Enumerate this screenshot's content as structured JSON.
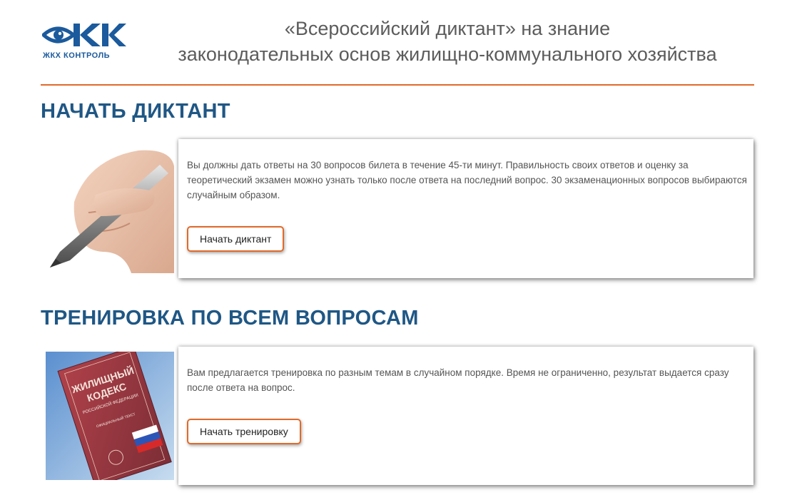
{
  "header": {
    "logo_text": "ЖКХ КОНТРОЛЬ",
    "title_line1": "«Всероссийский диктант» на знание",
    "title_line2": "законодательных основ жилищно-коммунального хозяйства"
  },
  "sections": [
    {
      "title": "НАЧАТЬ ДИКТАНТ",
      "image": "hand-with-pen-image",
      "description": "Вы должны дать ответы на 30 вопросов билета в течение 45-ти минут. Правильность своих ответов и оценку за теоретический экзамен можно узнать только после ответа на последний вопрос. 30 экзаменационных вопросов выбираются случайным образом.",
      "button_label": "Начать диктант"
    },
    {
      "title": "ТРЕНИРОВКА ПО ВСЕМ ВОПРОСАМ",
      "image": "housing-code-book-image",
      "book_line1": "ЖИЛИЩНЫЙ",
      "book_line2": "КОДЕКС",
      "book_line3": "РОССИЙСКОЙ ФЕДЕРАЦИИ",
      "book_line4": "ОФИЦИАЛЬНЫЙ ТЕКСТ",
      "description": "Вам предлагается тренировка по разным темам в случайном порядке. Время не ограниченно, результат выдается сразу после ответа на вопрос.",
      "button_label": "Начать тренировку"
    }
  ],
  "colors": {
    "accent": "#e06a2a",
    "heading": "#1f5785",
    "logo": "#1b5a9c",
    "text": "#555555"
  }
}
